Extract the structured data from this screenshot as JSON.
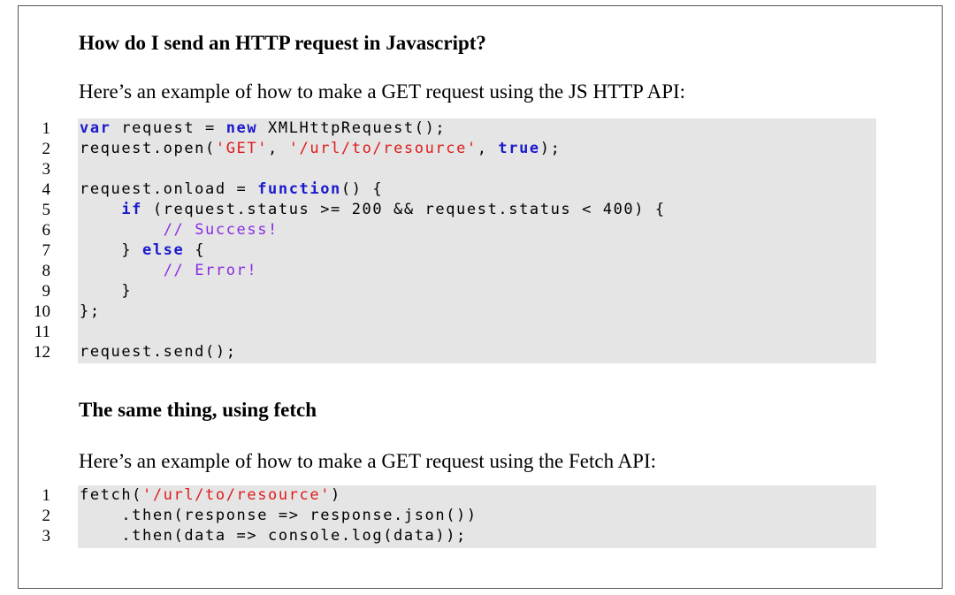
{
  "section1": {
    "heading": "How do I send an HTTP request in Javascript?",
    "intro": "Here’s an example of how to make a GET request using the JS HTTP API:",
    "code": [
      {
        "n": "1",
        "tokens": [
          {
            "t": "var",
            "c": "kw"
          },
          {
            "t": " request = ",
            "c": ""
          },
          {
            "t": "new",
            "c": "kw"
          },
          {
            "t": " XMLHttpRequest();",
            "c": ""
          }
        ]
      },
      {
        "n": "2",
        "tokens": [
          {
            "t": "request.open(",
            "c": ""
          },
          {
            "t": "'GET'",
            "c": "str"
          },
          {
            "t": ", ",
            "c": ""
          },
          {
            "t": "'/url/to/resource'",
            "c": "str"
          },
          {
            "t": ", ",
            "c": ""
          },
          {
            "t": "true",
            "c": "kw"
          },
          {
            "t": ");",
            "c": ""
          }
        ]
      },
      {
        "n": "3",
        "tokens": []
      },
      {
        "n": "4",
        "tokens": [
          {
            "t": "request.onload = ",
            "c": ""
          },
          {
            "t": "function",
            "c": "kw"
          },
          {
            "t": "() {",
            "c": ""
          }
        ]
      },
      {
        "n": "5",
        "tokens": [
          {
            "t": "    ",
            "c": ""
          },
          {
            "t": "if",
            "c": "kw"
          },
          {
            "t": " (request.status >= 200 && request.status < 400) {",
            "c": ""
          }
        ]
      },
      {
        "n": "6",
        "tokens": [
          {
            "t": "        ",
            "c": ""
          },
          {
            "t": "// Success!",
            "c": "cm"
          }
        ]
      },
      {
        "n": "7",
        "tokens": [
          {
            "t": "    } ",
            "c": ""
          },
          {
            "t": "else",
            "c": "kw"
          },
          {
            "t": " {",
            "c": ""
          }
        ]
      },
      {
        "n": "8",
        "tokens": [
          {
            "t": "        ",
            "c": ""
          },
          {
            "t": "// Error!",
            "c": "cm"
          }
        ]
      },
      {
        "n": "9",
        "tokens": [
          {
            "t": "    }",
            "c": ""
          }
        ]
      },
      {
        "n": "10",
        "tokens": [
          {
            "t": "};",
            "c": ""
          }
        ]
      },
      {
        "n": "11",
        "tokens": []
      },
      {
        "n": "12",
        "tokens": [
          {
            "t": "request.send();",
            "c": ""
          }
        ]
      }
    ]
  },
  "section2": {
    "heading": "The same thing, using fetch",
    "intro": "Here’s an example of how to make a GET request using the Fetch API:",
    "code": [
      {
        "n": "1",
        "tokens": [
          {
            "t": "fetch(",
            "c": ""
          },
          {
            "t": "'/url/to/resource'",
            "c": "str"
          },
          {
            "t": ")",
            "c": ""
          }
        ]
      },
      {
        "n": "2",
        "tokens": [
          {
            "t": "    .then(response => response.json())",
            "c": ""
          }
        ]
      },
      {
        "n": "3",
        "tokens": [
          {
            "t": "    .then(data => console.log(data));",
            "c": ""
          }
        ]
      }
    ]
  },
  "colors": {
    "keyword": "#1a1acc",
    "string": "#e01b1b",
    "comment": "#8a2be2",
    "code_background": "#e5e5e5"
  }
}
